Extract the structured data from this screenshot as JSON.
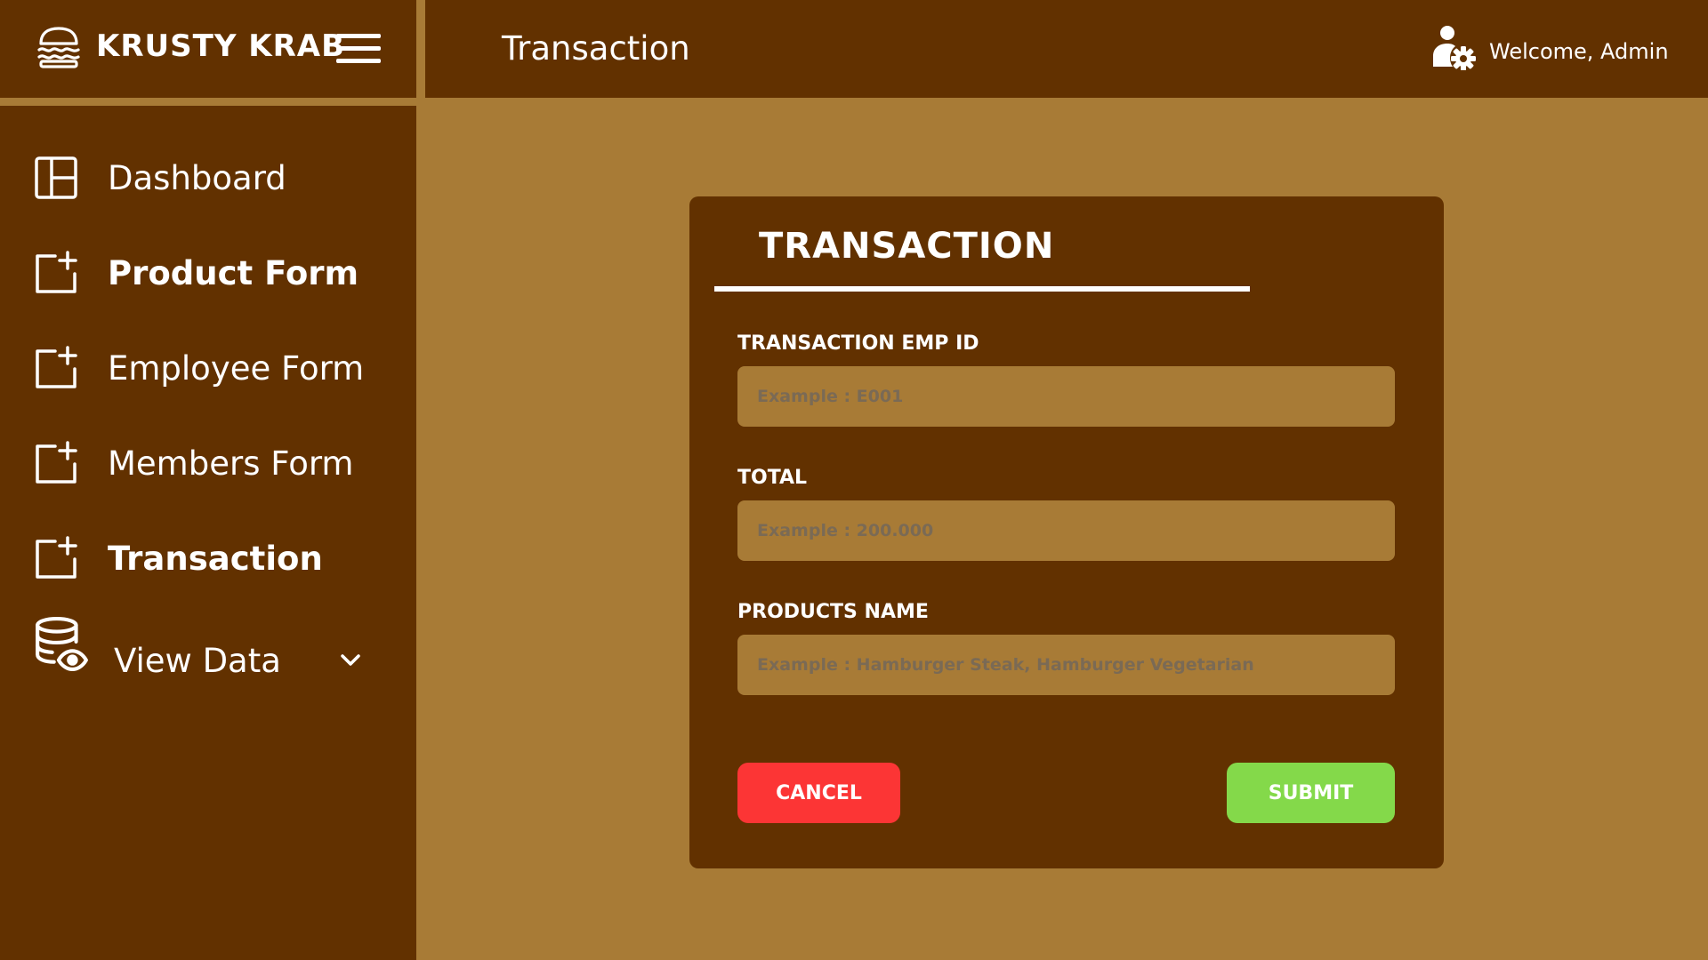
{
  "brand": {
    "name": "KRUSTY KRAB"
  },
  "sidebar": {
    "items": [
      {
        "label": "Dashboard",
        "icon": "dashboard-icon"
      },
      {
        "label": "Product Form",
        "icon": "add-box-icon"
      },
      {
        "label": "Employee Form",
        "icon": "add-box-icon"
      },
      {
        "label": "Members Form",
        "icon": "add-box-icon"
      },
      {
        "label": "Transaction",
        "icon": "add-box-icon"
      },
      {
        "label": "View Data",
        "icon": "database-eye-icon"
      }
    ]
  },
  "header": {
    "title": "Transaction",
    "welcome": "Welcome, Admin"
  },
  "form": {
    "title": "TRANSACTION",
    "fields": [
      {
        "label": "TRANSACTION EMP ID",
        "placeholder": "Example : E001",
        "value": ""
      },
      {
        "label": "TOTAL",
        "placeholder": "Example : 200.000",
        "value": ""
      },
      {
        "label": "PRODUCTS NAME",
        "placeholder": "Example : Hamburger Steak, Hamburger Vegetarian",
        "value": ""
      }
    ],
    "cancel_label": "CANCEL",
    "submit_label": "SUBMIT"
  },
  "colors": {
    "dark_brown": "#623100",
    "light_brown": "#a87b36",
    "cancel": "#fc3535",
    "submit": "#84d94a"
  }
}
